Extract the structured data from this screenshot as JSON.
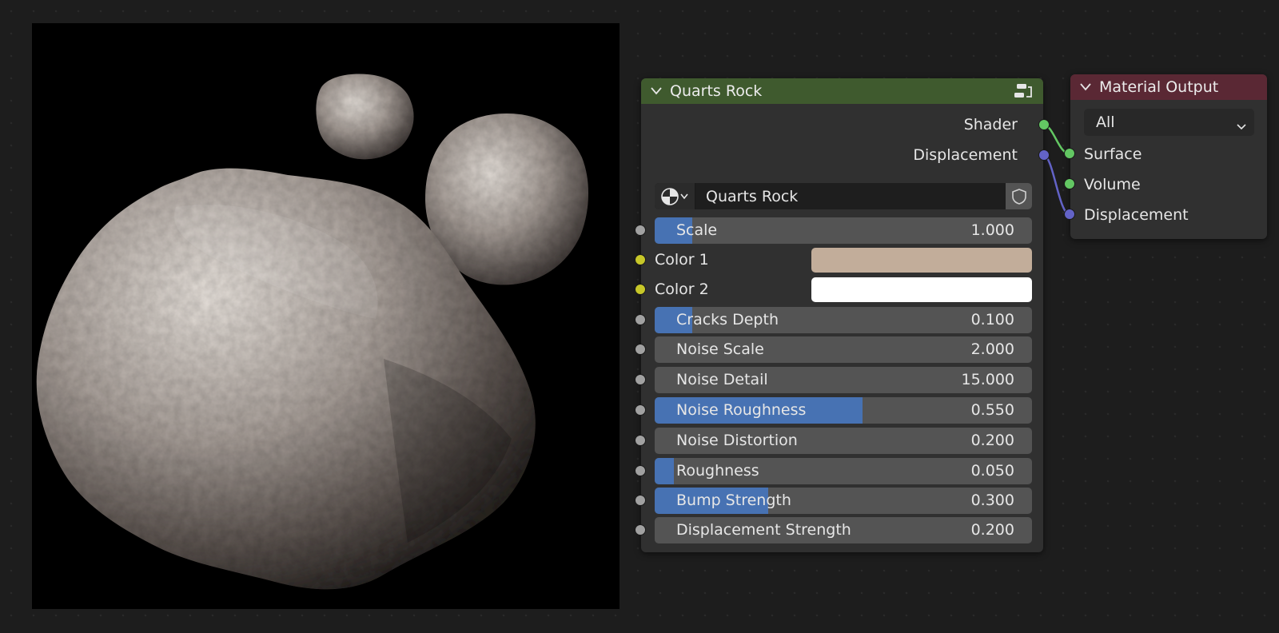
{
  "preview": {
    "description_icon": "rock-render"
  },
  "group_node": {
    "title": "Quarts Rock",
    "header_color": "#3f5a2e",
    "outputs": [
      {
        "label": "Shader",
        "socket_color": "#63c763"
      },
      {
        "label": "Displacement",
        "socket_color": "#6363c7"
      }
    ],
    "datablock": {
      "name": "Quarts Rock"
    },
    "inputs": [
      {
        "label": "Scale",
        "value": "1.000",
        "fill": 0
      },
      {
        "label": "Color 1",
        "color": "#c2ad9a"
      },
      {
        "label": "Color 2",
        "color": "#ffffff"
      },
      {
        "label": "Cracks Depth",
        "value": "0.100",
        "fill": 0.1
      },
      {
        "label": "Noise Scale",
        "value": "2.000",
        "fill": 0
      },
      {
        "label": "Noise Detail",
        "value": "15.000",
        "fill": 0
      },
      {
        "label": "Noise Roughness",
        "value": "0.550",
        "fill": 0.55
      },
      {
        "label": "Noise Distortion",
        "value": "0.200",
        "fill": 0
      },
      {
        "label": "Roughness",
        "value": "0.050",
        "fill": 0.05
      },
      {
        "label": "Bump Strength",
        "value": "0.300",
        "fill": 0.3
      },
      {
        "label": "Displacement Strength",
        "value": "0.200",
        "fill": 0
      }
    ]
  },
  "output_node": {
    "title": "Material Output",
    "header_color": "#5a2834",
    "target": "All",
    "inputs": [
      {
        "label": "Surface",
        "socket_color": "#63c763"
      },
      {
        "label": "Volume",
        "socket_color": "#63c763"
      },
      {
        "label": "Displacement",
        "socket_color": "#6363c7"
      }
    ]
  },
  "colors": {
    "accent_blue": "#4772b3",
    "field_bg": "#545454",
    "node_bg": "#303030",
    "socket_float": "#a1a1a1",
    "socket_color": "#c7c729"
  }
}
